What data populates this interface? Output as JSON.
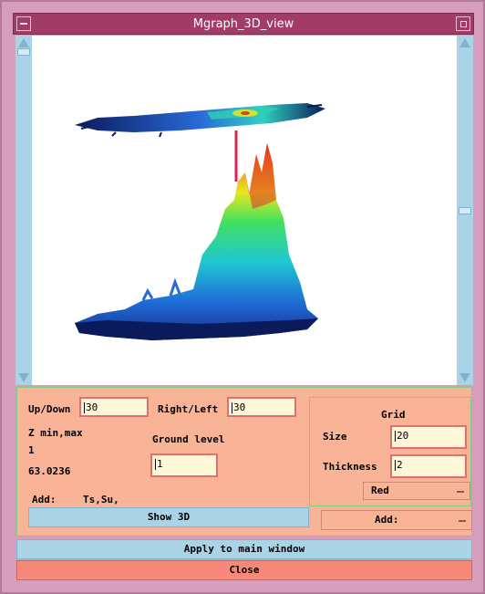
{
  "window": {
    "title": "Mgraph_3D_view"
  },
  "controls": {
    "updown_label": "Up/Down",
    "updown_value": "30",
    "rightleft_label": "Right/Left",
    "rightleft_value": "30",
    "zminmax_label": "Z min,max",
    "zmin_value": "1",
    "zmax_value": "63.0236",
    "ground_label": "Ground level",
    "ground_value": "1",
    "add_label": "Add:",
    "add_value": "Ts,Su,",
    "show3d_label": "Show 3D"
  },
  "grid": {
    "title": "Grid",
    "size_label": "Size",
    "size_value": "20",
    "thickness_label": "Thickness",
    "thickness_value": "2",
    "color_value": "Red",
    "add_dropdown_label": "Add:"
  },
  "footer": {
    "apply_label": "Apply to main window",
    "close_label": "Close"
  },
  "colors": {
    "title_bar": "#a03c65",
    "panel": "#f9b497",
    "blue_button": "#aad3e6",
    "close_button": "#f7897b",
    "field_border": "#e07070"
  }
}
